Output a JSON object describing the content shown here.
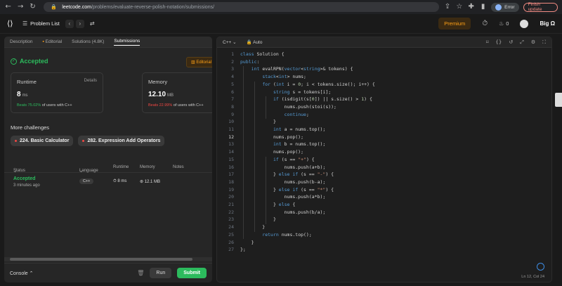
{
  "browser": {
    "url_host": "leetcode.com",
    "url_path": "/problems/evaluate-reverse-polish-notation/submissions/",
    "error_label": "Error",
    "finish_update_label": "Finish update"
  },
  "appbar": {
    "problem_list_label": "Problem List",
    "premium_label": "Premium",
    "streak_count": "0",
    "username": "Big Ω"
  },
  "left_tabs": [
    "Description",
    "Editorial",
    "Solutions (4.8K)",
    "Submissions"
  ],
  "result": {
    "status": "Accepted",
    "editorial_button": "Editorial",
    "runtime": {
      "label": "Runtime",
      "details_label": "Details",
      "value": "8",
      "unit": "ms",
      "beats_pct": "Beats 75.02%",
      "beats_rest": "of users with C++"
    },
    "memory": {
      "label": "Memory",
      "value": "12.10",
      "unit": "MB",
      "beats_pct": "Beats 22.99%",
      "beats_rest": "of users with C++"
    }
  },
  "more_challenges": {
    "title": "More challenges",
    "items": [
      "224. Basic Calculator",
      "282. Expression Add Operators"
    ]
  },
  "submissions_table": {
    "headers": [
      "Status",
      "Language",
      "Runtime",
      "Memory",
      "Notes"
    ],
    "rows": [
      {
        "status": "Accepted",
        "time_ago": "3 minutes ago",
        "language": "C++",
        "runtime": "8 ms",
        "memory": "12.1 MB"
      }
    ]
  },
  "bottom_bar": {
    "console_label": "Console",
    "run_label": "Run",
    "submit_label": "Submit"
  },
  "editor": {
    "language": "C++",
    "mode": "Auto",
    "status": "Ln 12, Col 24",
    "current_line": 12,
    "lines": [
      "class Solution {",
      "public:",
      "    int evalRPN(vector<string>& tokens) {",
      "        stack<int> nums;",
      "        for (int i = 0; i < tokens.size(); i++) {",
      "            string s = tokens[i];",
      "            if (isdigit(s[0]) || s.size() > 1) {",
      "                nums.push(stoi(s));",
      "                continue;",
      "            }",
      "            int a = nums.top();",
      "            nums.pop();",
      "            int b = nums.top();",
      "            nums.pop();",
      "            if (s == \"+\") {",
      "                nums.push(a+b);",
      "            } else if (s == \"-\") {",
      "                nums.push(b-a);",
      "            } else if (s == \"*\") {",
      "                nums.push(a*b);",
      "            } else {",
      "                nums.push(b/a);",
      "            }",
      "        }",
      "        return nums.top();",
      "    }",
      "};"
    ]
  },
  "colors": {
    "accent": "#ffa116",
    "success": "#2cbb5d",
    "error": "#ef4743"
  }
}
